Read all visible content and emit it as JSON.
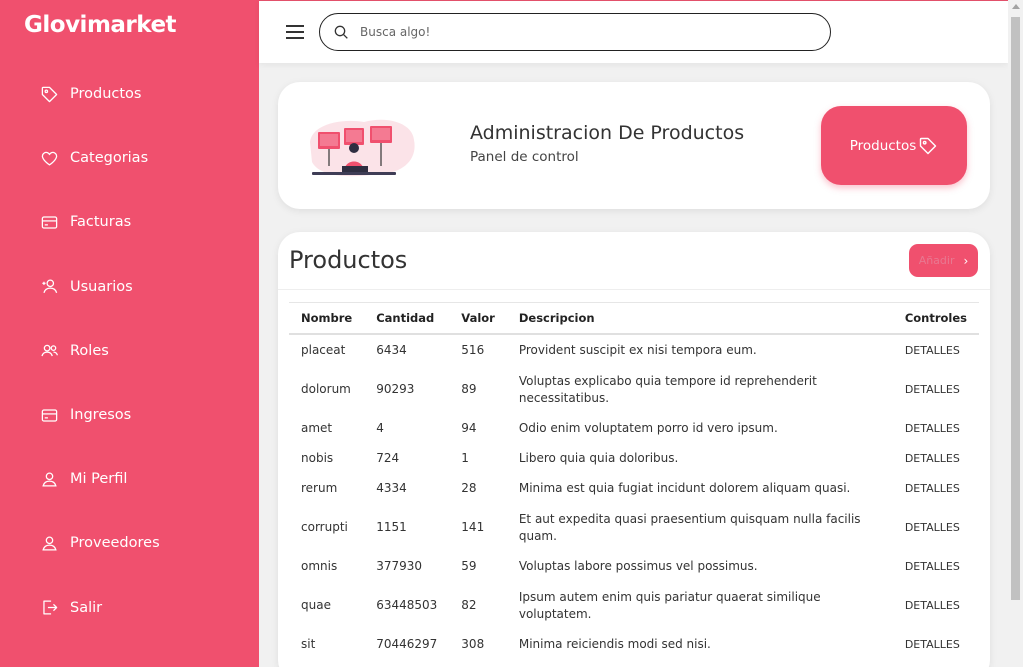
{
  "brand": "Glovimarket",
  "nav": [
    {
      "label": "Productos",
      "icon": "tag-icon"
    },
    {
      "label": "Categorias",
      "icon": "heart-icon"
    },
    {
      "label": "Facturas",
      "icon": "credit-card-icon"
    },
    {
      "label": "Usuarios",
      "icon": "user-plus-icon"
    },
    {
      "label": "Roles",
      "icon": "users-icon"
    },
    {
      "label": "Ingresos",
      "icon": "credit-card-icon"
    },
    {
      "label": "Mi Perfil",
      "icon": "user-icon"
    },
    {
      "label": "Proveedores",
      "icon": "user-icon"
    },
    {
      "label": "Salir",
      "icon": "sign-out-icon"
    }
  ],
  "search": {
    "placeholder": "Busca algo!",
    "value": ""
  },
  "hero": {
    "title": "Administracion De Productos",
    "subtitle": "Panel de control",
    "button_label": "Productos"
  },
  "products": {
    "title": "Productos",
    "add_label": "Añadir",
    "columns": [
      "Nombre",
      "Cantidad",
      "Valor",
      "Descripcion",
      "Controles"
    ],
    "rows": [
      {
        "nombre": "placeat",
        "cantidad": "6434",
        "valor": "516",
        "descripcion": "Provident suscipit ex nisi tempora eum.",
        "control": "DETALLES"
      },
      {
        "nombre": "dolorum",
        "cantidad": "90293",
        "valor": "89",
        "descripcion": "Voluptas explicabo quia tempore id reprehenderit necessitatibus.",
        "control": "DETALLES"
      },
      {
        "nombre": "amet",
        "cantidad": "4",
        "valor": "94",
        "descripcion": "Odio enim voluptatem porro id vero ipsum.",
        "control": "DETALLES"
      },
      {
        "nombre": "nobis",
        "cantidad": "724",
        "valor": "1",
        "descripcion": "Libero quia quia doloribus.",
        "control": "DETALLES"
      },
      {
        "nombre": "rerum",
        "cantidad": "4334",
        "valor": "28",
        "descripcion": "Minima est quia fugiat incidunt dolorem aliquam quasi.",
        "control": "DETALLES"
      },
      {
        "nombre": "corrupti",
        "cantidad": "1151",
        "valor": "141",
        "descripcion": "Et aut expedita quasi praesentium quisquam nulla facilis quam.",
        "control": "DETALLES"
      },
      {
        "nombre": "omnis",
        "cantidad": "377930",
        "valor": "59",
        "descripcion": "Voluptas labore possimus vel possimus.",
        "control": "DETALLES"
      },
      {
        "nombre": "quae",
        "cantidad": "63448503",
        "valor": "82",
        "descripcion": "Ipsum autem enim quis pariatur quaerat similique voluptatem.",
        "control": "DETALLES"
      },
      {
        "nombre": "sit",
        "cantidad": "70446297",
        "valor": "308",
        "descripcion": "Minima reiciendis modi sed nisi.",
        "control": "DETALLES"
      }
    ]
  },
  "colors": {
    "accent": "#f0506e",
    "text": "#333333",
    "background": "#f1f1f1"
  }
}
